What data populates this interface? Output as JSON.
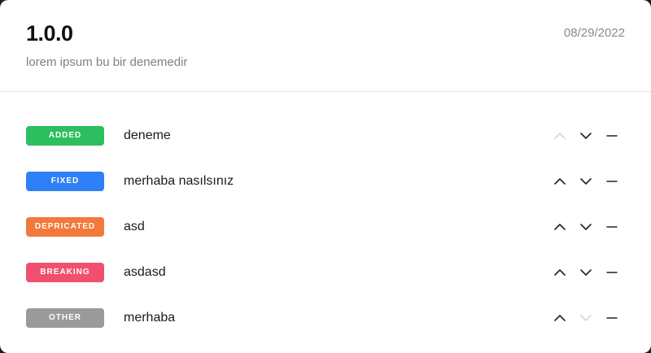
{
  "release": {
    "version": "1.0.0",
    "description": "lorem ipsum bu bir denemedir",
    "date": "08/29/2022"
  },
  "entries": [
    {
      "type": "ADDED",
      "color": "#2dbe60",
      "text": "deneme",
      "up_enabled": false,
      "down_enabled": true
    },
    {
      "type": "FIXED",
      "color": "#2f80f6",
      "text": "merhaba nasılsınız",
      "up_enabled": true,
      "down_enabled": true
    },
    {
      "type": "DEPRICATED",
      "color": "#f2793b",
      "text": "asd",
      "up_enabled": true,
      "down_enabled": true
    },
    {
      "type": "BREAKING",
      "color": "#f0506e",
      "text": "asdasd",
      "up_enabled": true,
      "down_enabled": true
    },
    {
      "type": "OTHER",
      "color": "#9a9a9a",
      "text": "merhaba",
      "up_enabled": true,
      "down_enabled": false
    }
  ],
  "icons": {
    "move_up": "chevron-up-icon",
    "move_down": "chevron-down-icon",
    "remove": "minus-icon"
  }
}
